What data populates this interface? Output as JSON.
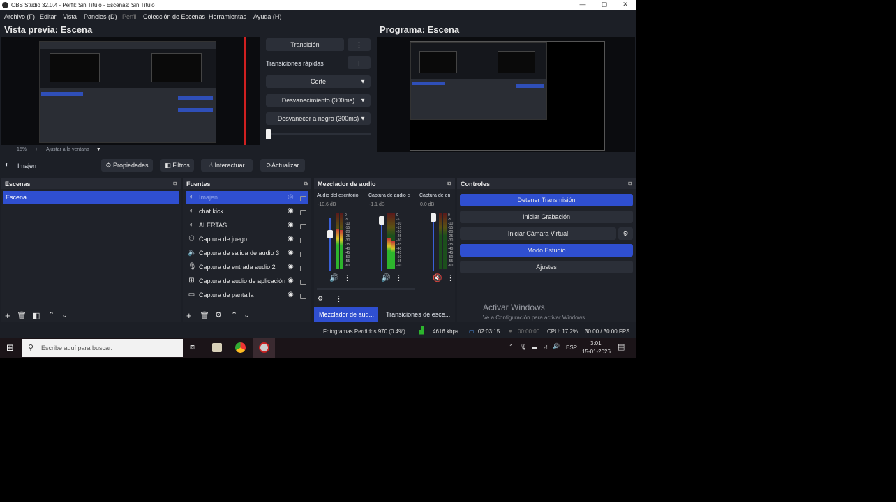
{
  "window": {
    "title": "OBS Studio 32.0.4 - Perfil: Sin Título - Escenas: Sin Título"
  },
  "menu": [
    "Archivo (F)",
    "Editar",
    "Vista",
    "Paneles (D)",
    "Perfil",
    "Colección de Escenas",
    "Herramientas",
    "Ayuda (H)"
  ],
  "preview": {
    "title": "Vista previa: Escena",
    "zoom": "15%",
    "fit_label": "Ajustar a la ventana"
  },
  "program": {
    "title": "Programa: Escena"
  },
  "transitions": {
    "transition_button": "Transición",
    "quick_label": "Transiciones rápidas",
    "items": [
      "Corte",
      "Desvanecimiento (300ms)",
      "Desvanecer a negro (300ms)"
    ]
  },
  "source_toolbar": {
    "selected": "Imajen",
    "props": "Propiedades",
    "filters": "Filtros",
    "interact": "Interactuar",
    "refresh": "Actualizar"
  },
  "scenes": {
    "title": "Escenas",
    "items": [
      "Escena"
    ]
  },
  "sources": {
    "title": "Fuentes",
    "items": [
      "Imajen",
      "chat kick",
      "ALERTAS",
      "Captura de juego",
      "Captura de salida de audio 3",
      "Captura de entrada audio 2",
      "Captura de audio de aplicación",
      "Captura de pantalla"
    ]
  },
  "mixer": {
    "title": "Mezclador de audio",
    "channels": [
      {
        "name": "Audio del escritorio",
        "db": "-10.6 dB"
      },
      {
        "name": "Captura de audio c",
        "db": "-1.1 dB"
      },
      {
        "name": "Captura de en",
        "db": "0.0 dB"
      }
    ],
    "scale": [
      "0",
      "-5",
      "-10",
      "-15",
      "-20",
      "-25",
      "-30",
      "-35",
      "-40",
      "-45",
      "-50",
      "-55",
      "-60"
    ],
    "tabs": [
      "Mezclador de aud...",
      "Transiciones de esce..."
    ]
  },
  "controls": {
    "title": "Controles",
    "stop_stream": "Detener Transmisión",
    "start_record": "Iniciar Grabación",
    "virtual_cam": "Iniciar Cámara Virtual",
    "studio_mode": "Modo Estudio",
    "settings": "Ajustes"
  },
  "watermark": {
    "title": "Activar Windows",
    "subtitle": "Ve a Configuración para activar Windows."
  },
  "status": {
    "dropped": "Fotogramas Perdidos 970 (0.4%)",
    "bitrate": "4616 kbps",
    "stream_time": "02:03:15",
    "rec_time": "00:00:00",
    "cpu": "CPU: 17.2%",
    "fps": "30.00 / 30.00 FPS"
  },
  "taskbar": {
    "search_placeholder": "Escribe aquí para buscar.",
    "lang": "ESP",
    "time": "3:01",
    "date": "15-01-2026"
  },
  "colors": {
    "accent": "#2f4fd0",
    "bg": "#1c1f26",
    "panel": "#1f2229"
  }
}
